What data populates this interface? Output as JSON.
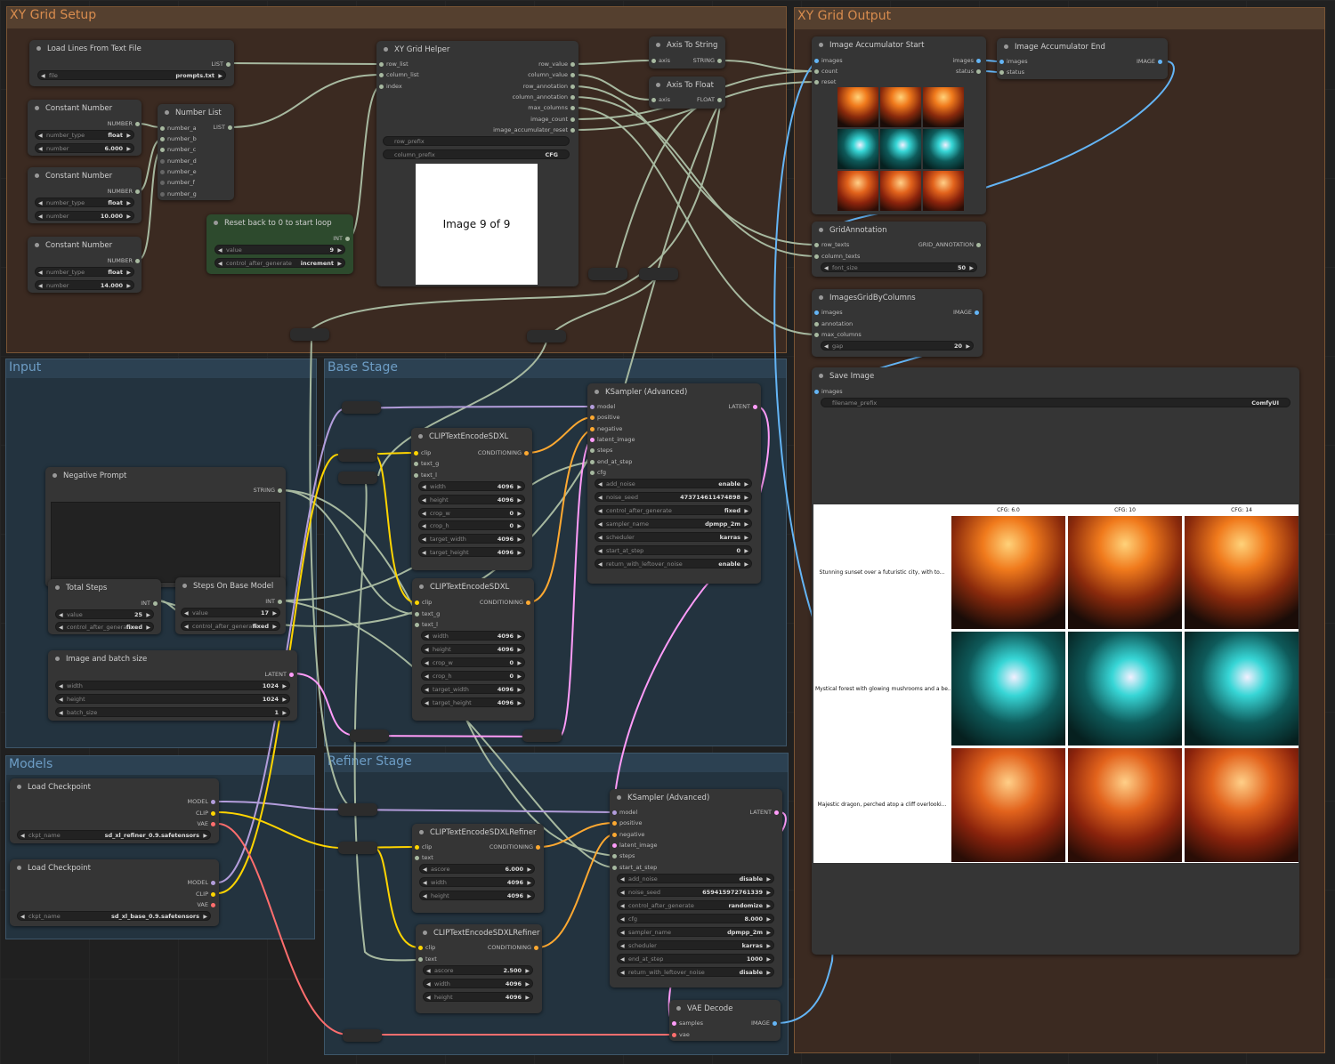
{
  "groups": {
    "xy_setup": "XY Grid Setup",
    "xy_output": "XY Grid Output",
    "input": "Input",
    "base": "Base Stage",
    "models": "Models",
    "refiner": "Refiner Stage"
  },
  "colors": {
    "model": "#b39ddb",
    "clip": "#ffd500",
    "vae": "#ff6e6e",
    "latent": "#ff9cf9",
    "image": "#64b5f6",
    "conditioning": "#ffa931",
    "generic": "#a7b9a0"
  },
  "load_lines": {
    "title": "Load Lines From Text File",
    "out": "LIST",
    "file_label": "file",
    "file": "prompts.txt"
  },
  "const1": {
    "title": "Constant Number",
    "out": "NUMBER",
    "type_label": "number_type",
    "type": "float",
    "num_label": "number",
    "num": "6.000"
  },
  "const2": {
    "title": "Constant Number",
    "out": "NUMBER",
    "type_label": "number_type",
    "type": "float",
    "num_label": "number",
    "num": "10.000"
  },
  "const3": {
    "title": "Constant Number",
    "out": "NUMBER",
    "type_label": "number_type",
    "type": "float",
    "num_label": "number",
    "num": "14.000"
  },
  "number_list": {
    "title": "Number List",
    "out": "LIST",
    "inputs": [
      "number_a",
      "number_b",
      "number_c",
      "number_d",
      "number_e",
      "number_f",
      "number_g"
    ]
  },
  "reset": {
    "title": "Reset back to 0 to start loop",
    "out": "INT",
    "value_label": "value",
    "value": "9",
    "cag_label": "control_after_generate",
    "cag": "increment"
  },
  "xy_helper": {
    "title": "XY Grid Helper",
    "inputs": [
      "row_list",
      "column_list",
      "index"
    ],
    "outputs": [
      "row_value",
      "column_value",
      "row_annotation",
      "column_annotation",
      "max_columns",
      "image_count",
      "image_accumulator_reset"
    ],
    "row_prefix": "row_prefix",
    "column_prefix_label": "column_prefix",
    "column_prefix": "CFG",
    "preview": "Image 9 of 9"
  },
  "axis_string": {
    "title": "Axis To String",
    "in": "axis",
    "out": "STRING"
  },
  "axis_float": {
    "title": "Axis To Float",
    "in": "axis",
    "out": "FLOAT"
  },
  "acc_start": {
    "title": "Image Accumulator Start",
    "inputs": [
      "images",
      "count",
      "reset"
    ],
    "outputs": [
      "images",
      "status"
    ]
  },
  "acc_end": {
    "title": "Image Accumulator End",
    "inputs": [
      "images",
      "status"
    ],
    "out": "IMAGE"
  },
  "grid_annot": {
    "title": "GridAnnotation",
    "inputs": [
      "row_texts",
      "column_texts"
    ],
    "out": "GRID_ANNOTATION",
    "fs_label": "font_size",
    "fs": "50"
  },
  "grid_cols": {
    "title": "ImagesGridByColumns",
    "inputs": [
      "images",
      "annotation",
      "max_columns"
    ],
    "out": "IMAGE",
    "gap_label": "gap",
    "gap": "20"
  },
  "save": {
    "title": "Save Image",
    "in": "images",
    "prefix_label": "filename_prefix",
    "prefix": "ComfyUI"
  },
  "grid_result": {
    "cols": [
      "CFG: 6.0",
      "CFG: 10",
      "CFG: 14"
    ],
    "rows": [
      "Stunning sunset over a futuristic city, with to...",
      "Mystical forest with glowing mushrooms and a be...",
      "Majestic dragon, perched atop a cliff overlooki..."
    ]
  },
  "neg": {
    "title": "Negative Prompt",
    "out": "STRING"
  },
  "total_steps": {
    "title": "Total Steps",
    "out": "INT",
    "value_label": "value",
    "value": "25",
    "cag_label": "control_after_generate",
    "cag": "fixed"
  },
  "steps_base": {
    "title": "Steps On Base Model",
    "out": "INT",
    "value_label": "value",
    "value": "17",
    "cag_label": "control_after_generate",
    "cag": "fixed"
  },
  "img_size": {
    "title": "Image and batch size",
    "out": "LATENT",
    "w_label": "width",
    "w": "1024",
    "h_label": "height",
    "h": "1024",
    "b_label": "batch_size",
    "b": "1"
  },
  "clip1": {
    "title": "CLIPTextEncodeSDXL",
    "inputs": [
      "clip",
      "text_g",
      "text_l"
    ],
    "out": "CONDITIONING",
    "widgets": [
      [
        "width",
        "4096"
      ],
      [
        "height",
        "4096"
      ],
      [
        "crop_w",
        "0"
      ],
      [
        "crop_h",
        "0"
      ],
      [
        "target_width",
        "4096"
      ],
      [
        "target_height",
        "4096"
      ]
    ]
  },
  "clip2": {
    "title": "CLIPTextEncodeSDXL",
    "inputs": [
      "clip",
      "text_g",
      "text_l"
    ],
    "out": "CONDITIONING",
    "widgets": [
      [
        "width",
        "4096"
      ],
      [
        "height",
        "4096"
      ],
      [
        "crop_w",
        "0"
      ],
      [
        "crop_h",
        "0"
      ],
      [
        "target_width",
        "4096"
      ],
      [
        "target_height",
        "4096"
      ]
    ]
  },
  "ks1": {
    "title": "KSampler (Advanced)",
    "inputs": [
      "model",
      "positive",
      "negative",
      "latent_image",
      "steps",
      "end_at_step",
      "cfg"
    ],
    "out": "LATENT",
    "widgets": [
      [
        "add_noise",
        "enable"
      ],
      [
        "noise_seed",
        "473714611474898"
      ],
      [
        "control_after_generate",
        "fixed"
      ],
      [
        "sampler_name",
        "dpmpp_2m"
      ],
      [
        "scheduler",
        "karras"
      ],
      [
        "start_at_step",
        "0"
      ],
      [
        "return_with_leftover_noise",
        "enable"
      ]
    ]
  },
  "ckpt1": {
    "title": "Load Checkpoint",
    "outputs": [
      "MODEL",
      "CLIP",
      "VAE"
    ],
    "label": "ckpt_name",
    "value": "sd_xl_refiner_0.9.safetensors"
  },
  "ckpt2": {
    "title": "Load Checkpoint",
    "outputs": [
      "MODEL",
      "CLIP",
      "VAE"
    ],
    "label": "ckpt_name",
    "value": "sd_xl_base_0.9.safetensors"
  },
  "clipr1": {
    "title": "CLIPTextEncodeSDXLRefiner",
    "inputs": [
      "clip",
      "text"
    ],
    "out": "CONDITIONING",
    "widgets": [
      [
        "ascore",
        "6.000"
      ],
      [
        "width",
        "4096"
      ],
      [
        "height",
        "4096"
      ]
    ]
  },
  "clipr2": {
    "title": "CLIPTextEncodeSDXLRefiner",
    "inputs": [
      "clip",
      "text"
    ],
    "out": "CONDITIONING",
    "widgets": [
      [
        "ascore",
        "2.500"
      ],
      [
        "width",
        "4096"
      ],
      [
        "height",
        "4096"
      ]
    ]
  },
  "ks2": {
    "title": "KSampler (Advanced)",
    "inputs": [
      "model",
      "positive",
      "negative",
      "latent_image",
      "steps",
      "start_at_step"
    ],
    "out": "LATENT",
    "widgets": [
      [
        "add_noise",
        "disable"
      ],
      [
        "noise_seed",
        "659415972761339"
      ],
      [
        "control_after_generate",
        "randomize"
      ],
      [
        "cfg",
        "8.000"
      ],
      [
        "sampler_name",
        "dpmpp_2m"
      ],
      [
        "scheduler",
        "karras"
      ],
      [
        "end_at_step",
        "1000"
      ],
      [
        "return_with_leftover_noise",
        "disable"
      ]
    ]
  },
  "vae": {
    "title": "VAE Decode",
    "inputs": [
      "samples",
      "vae"
    ],
    "out": "IMAGE"
  }
}
